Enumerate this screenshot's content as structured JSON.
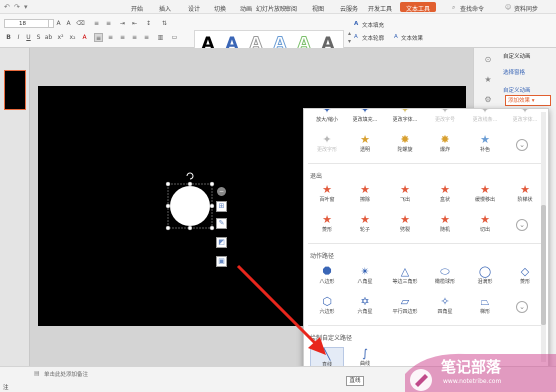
{
  "menu": {
    "items": [
      "开始",
      "插入",
      "设计",
      "切换",
      "动画",
      "幻灯片放映",
      "审阅",
      "视图",
      "云服务",
      "开发工具",
      "文本工具"
    ],
    "active": "文本工具",
    "search": "查找命令",
    "user": "资料同步"
  },
  "ribbon": {
    "font_name": "",
    "font_size": "18",
    "text_fill": "文本填充",
    "text_outline": "文本轮廓",
    "text_effect": "文本效果",
    "art_letters": [
      "A",
      "A",
      "A",
      "A",
      "A",
      "A"
    ]
  },
  "rpanel": {
    "title": "自定义动画",
    "select_pane": "选择窗格",
    "custom_anim": "自定义动画",
    "add_effect": "添加效果"
  },
  "effects": {
    "top_row1": [
      "放大/缩小",
      "更改填充...",
      "更改字体...",
      "更改字号",
      "更改线条...",
      "更改字体..."
    ],
    "top_row2": [
      "更改字形",
      "透明",
      "陀螺旋",
      "爆炸",
      "补色"
    ],
    "exit_title": "退出",
    "exit_row1": [
      "百叶窗",
      "擦除",
      "飞出",
      "盒状",
      "缓慢移出",
      "阶梯状"
    ],
    "exit_row2": [
      "菱形",
      "轮子",
      "劈裂",
      "随机",
      "切出"
    ],
    "path_title": "动作路径",
    "path_row1": [
      "八边形",
      "八角星",
      "等边三角形",
      "橄榄球形",
      "泪滴形",
      "菱形"
    ],
    "path_row2": [
      "六边形",
      "六角星",
      "平行四边形",
      "四角星",
      "梯形"
    ],
    "custom_title": "绘制自定义路径",
    "custom_items": [
      "直线",
      "曲线"
    ],
    "tooltip": "直线"
  },
  "status": {
    "notes": "单击此处添加备注",
    "left": "注"
  },
  "watermark": {
    "title": "笔记部落",
    "url": "www.notetribe.com"
  },
  "colors": {
    "accent": "#e15f2f",
    "arrow": "#e8261c",
    "star": "#e25a3c"
  }
}
